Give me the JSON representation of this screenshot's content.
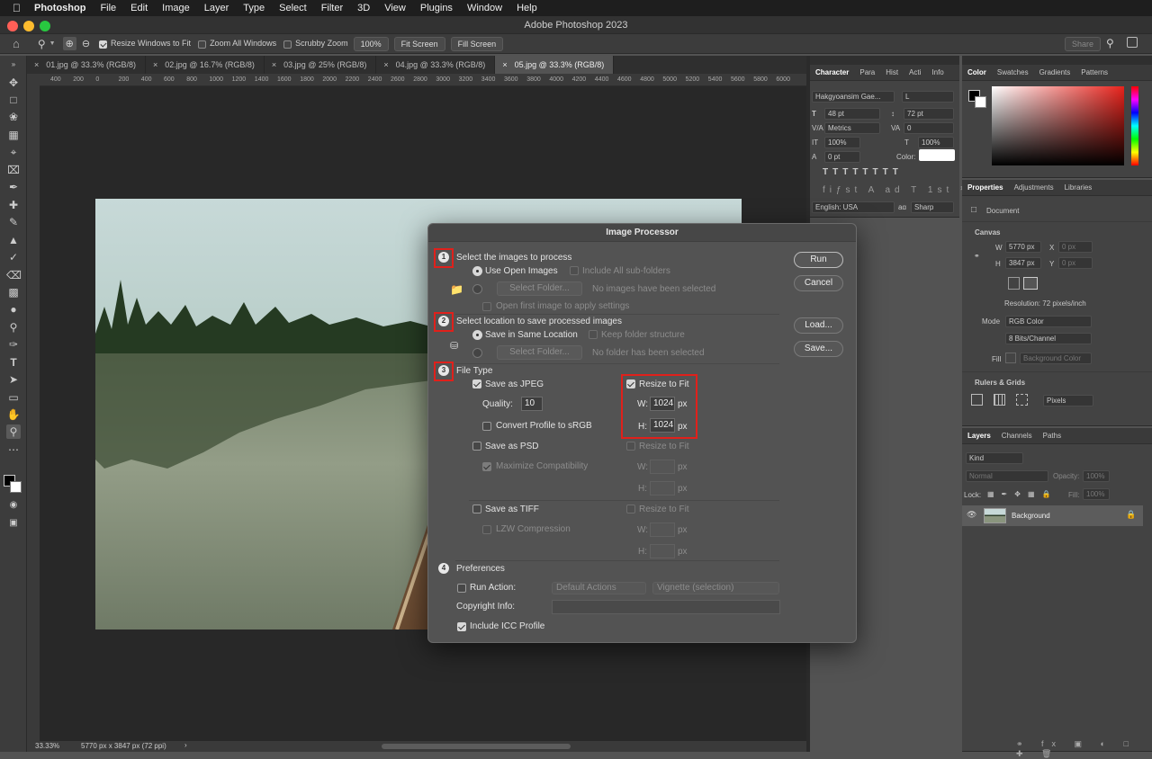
{
  "menubar": {
    "app": "Photoshop",
    "items": [
      "File",
      "Edit",
      "Image",
      "Layer",
      "Type",
      "Select",
      "Filter",
      "3D",
      "View",
      "Plugins",
      "Window",
      "Help"
    ]
  },
  "window": {
    "title": "Adobe Photoshop 2023"
  },
  "options": {
    "resize_windows": "Resize Windows to Fit",
    "zoom_all": "Zoom All Windows",
    "scrubby": "Scrubby Zoom",
    "zoom_pct": "100%",
    "fit_screen": "Fit Screen",
    "fill_screen": "Fill Screen",
    "share": "Share"
  },
  "tabs": [
    "01.jpg @ 33.3% (RGB/8)",
    "02.jpg @ 16.7% (RGB/8)",
    "03.jpg @ 25% (RGB/8)",
    "04.jpg @ 33.3% (RGB/8)",
    "05.jpg @ 33.3% (RGB/8)"
  ],
  "ruler_ticks": [
    "400",
    "200",
    "0",
    "200",
    "400",
    "600",
    "800",
    "1000",
    "1200",
    "1400",
    "1600",
    "1800",
    "2000",
    "2200",
    "2400",
    "2600",
    "2800",
    "3000",
    "3200",
    "3400",
    "3600",
    "3800",
    "4000",
    "4200",
    "4400",
    "4600",
    "4800",
    "5000",
    "5200",
    "5400",
    "5600",
    "5800",
    "6000"
  ],
  "status": {
    "zoom": "33.33%",
    "doc_info": "5770 px x 3847 px (72 ppi)"
  },
  "character": {
    "tabs": [
      "Character",
      "Para",
      "Hist",
      "Acti",
      "Info"
    ],
    "font": "Hakgyoansim Gae...",
    "style": "L",
    "size": "48 pt",
    "leading": "72 pt",
    "kerning": "Metrics",
    "tracking": "0",
    "vscale": "100%",
    "hscale": "100%",
    "baseline": "0 pt",
    "color_label": "Color:",
    "language": "English: USA",
    "aa_label": "aɑ",
    "antialias": "Sharp"
  },
  "color_panel": {
    "tabs": [
      "Color",
      "Swatches",
      "Gradients",
      "Patterns"
    ]
  },
  "properties": {
    "tabs": [
      "Properties",
      "Adjustments",
      "Libraries"
    ],
    "doc": "Document",
    "canvas": "Canvas",
    "w_label": "W",
    "w": "5770 px",
    "h_label": "H",
    "h": "3847 px",
    "x_label": "X",
    "x": "0 px",
    "y_label": "Y",
    "y": "0 px",
    "resolution": "Resolution: 72 pixels/inch",
    "mode_label": "Mode",
    "mode": "RGB Color",
    "depth": "8 Bits/Channel",
    "fill_label": "Fill",
    "fill": "Background Color",
    "rulers": "Rulers & Grids",
    "units": "Pixels"
  },
  "layers": {
    "tabs": [
      "Layers",
      "Channels",
      "Paths"
    ],
    "kind": "Kind",
    "blend": "Normal",
    "opacity_label": "Opacity:",
    "opacity": "100%",
    "lock_label": "Lock:",
    "fill_label": "Fill:",
    "fill": "100%",
    "items": [
      {
        "name": "Background"
      }
    ]
  },
  "dialog": {
    "title": "Image Processor",
    "s1": {
      "num": "1",
      "title": "Select the images to process",
      "use_open": "Use Open Images",
      "include_sub": "Include All sub-folders",
      "select_folder": "Select Folder...",
      "no_images": "No images have been selected",
      "open_first": "Open first image to apply settings"
    },
    "s2": {
      "num": "2",
      "title": "Select location to save processed images",
      "same_loc": "Save in Same Location",
      "keep_structure": "Keep folder structure",
      "select_folder": "Select Folder...",
      "no_folder": "No folder has been selected"
    },
    "s3": {
      "num": "3",
      "title": "File Type",
      "jpeg": "Save as JPEG",
      "quality_label": "Quality:",
      "quality": "10",
      "convert": "Convert Profile to sRGB",
      "resize": "Resize to Fit",
      "w_label": "W:",
      "w": "1024",
      "h_label": "H:",
      "h": "1024",
      "px": "px",
      "psd": "Save as PSD",
      "maximize": "Maximize Compatibility",
      "tiff": "Save as TIFF",
      "lzw": "LZW Compression"
    },
    "s4": {
      "num": "4",
      "title": "Preferences",
      "run_action": "Run Action:",
      "action_set": "Default Actions",
      "action": "Vignette (selection)",
      "copyright": "Copyright Info:",
      "icc": "Include ICC Profile"
    },
    "buttons": {
      "run": "Run",
      "cancel": "Cancel",
      "load": "Load...",
      "save": "Save..."
    }
  }
}
